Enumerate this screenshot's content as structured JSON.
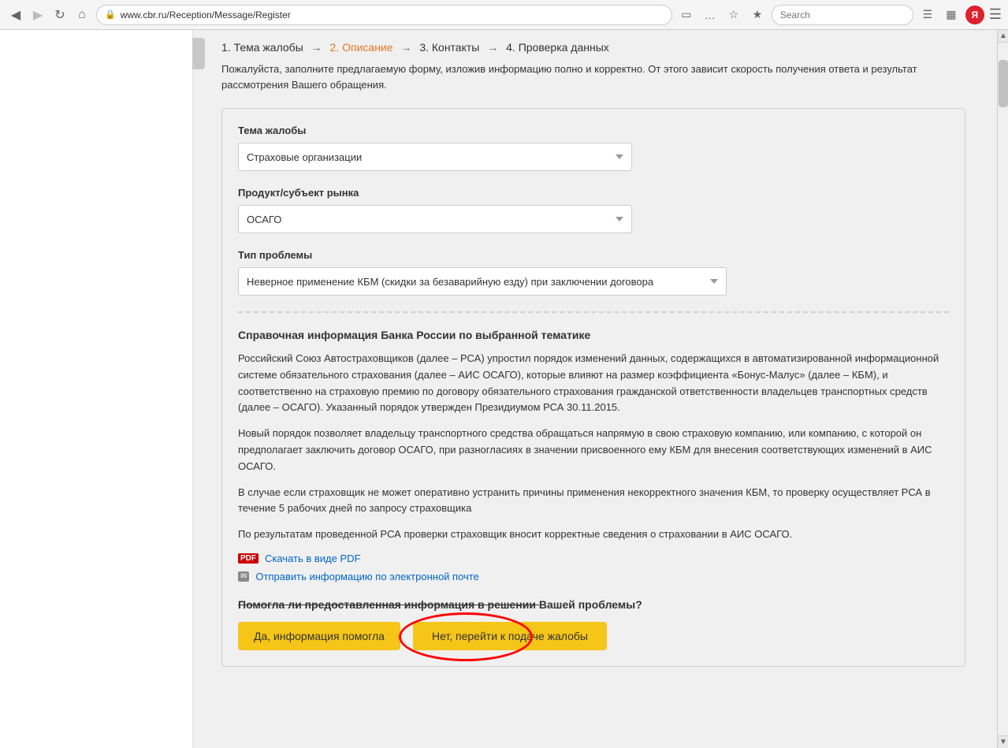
{
  "browser": {
    "url": "www.cbr.ru/Reception/Message/Register",
    "search_placeholder": "Search",
    "nav_back": "◀",
    "nav_forward": "▶",
    "nav_refresh": "↻",
    "nav_home": "⌂",
    "menu_dots": "…",
    "bookmark": "☆",
    "yandex_letter": "Я"
  },
  "breadcrumb": {
    "step1": "1. Тема жалобы",
    "arrow1": "→",
    "step2": "2. Описание",
    "arrow2": "→",
    "step3": "3. Контакты",
    "arrow3": "→",
    "step4": "4. Проверка данных"
  },
  "description": "Пожалуйста, заполните предлагаемую форму, изложив информацию полно и корректно. От этого зависит скорость получения ответа и результат рассмотрения Вашего обращения.",
  "form": {
    "topic_label": "Тема жалобы",
    "topic_value": "Страховые организации",
    "product_label": "Продукт/субъект рынка",
    "product_value": "ОСАГО",
    "problem_label": "Тип проблемы",
    "problem_value": "Неверное применение КБМ (скидки за безаварийную езду) при заключении договора"
  },
  "reference": {
    "title": "Справочная информация Банка России по выбранной тематике",
    "paragraph1": "Российский Союз Автостраховщиков (далее – РСА) упростил порядок изменений данных, содержащихся в автоматизированной информационной системе обязательного страхования (далее – АИС ОСАГО), которые влияют на размер коэффициента «Бонус-Малус» (далее – КБМ), и соответственно на страховую премию по договору обязательного страхования гражданской ответственности владельцев транспортных средств (далее – ОСАГО). Указанный порядок утвержден Президиумом РСА 30.11.2015.",
    "paragraph2": "Новый порядок позволяет владельцу транспортного средства обращаться напрямую в свою страховую компанию, или компанию, с которой он предполагает заключить договор ОСАГО, при разногласиях в значении присвоенного ему КБМ для внесения соответствующих изменений в АИС ОСАГО.",
    "paragraph3": "В случае если страховщик не может оперативно устранить причины применения некорректного значения КБМ, то проверку осуществляет РСА в течение 5 рабочих дней по запросу страховщика",
    "paragraph4": "По результатам проведенной РСА проверки страховщик вносит корректные сведения о страховании в АИС ОСАГО.",
    "pdf_link": "Скачать в виде PDF",
    "pdf_badge": "PDF",
    "email_link": "Отправить информацию по электронной почте",
    "email_badge": "✉"
  },
  "help": {
    "question": "Помогла ли предоставленная информация в решении Вашей проблемы?",
    "btn_yes": "Да, информация помогла",
    "btn_no": "Нет, перейти к подаче жалобы"
  }
}
